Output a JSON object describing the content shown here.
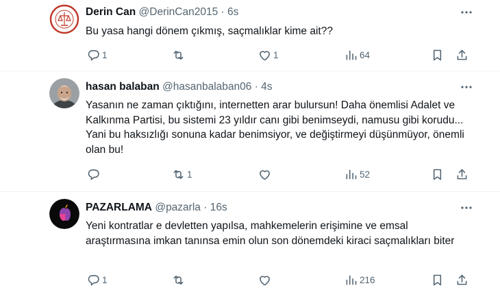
{
  "tweets": [
    {
      "name": "Derin Can",
      "handle": "@DerinCan2015",
      "separator": "·",
      "time": "6s",
      "text": "Bu yasa hangi dönem çıkmış, saçmalıklar kime ait??",
      "replies": "1",
      "reposts": "",
      "likes": "1",
      "views": "64",
      "avatar_colors": {
        "ring": "#c0392b",
        "bg": "#ffffff"
      }
    },
    {
      "name": "hasan balaban",
      "handle": "@hasanbalaban06",
      "separator": "·",
      "time": "4s",
      "text": "Yasanın ne zaman çıktığını, internetten arar bulursun! Daha önemlisi  Adalet ve Kalkınma Partisi, bu sistemi 23 yıldır canı gibi benimseydi, namusu gibi korudu... Yani bu haksızlığı sonuna kadar benimsiyor, ve değiştirmeyi düşünmüyor, önemli olan bu!",
      "replies": "",
      "reposts": "1",
      "likes": "",
      "views": "52",
      "avatar_colors": {
        "bg": "#8a8f92",
        "face": "#c9a48a"
      }
    },
    {
      "name": "PAZARLAMA",
      "handle": "@pazarla",
      "separator": "·",
      "time": "16s",
      "text": "Yeni kontratlar e devletten yapılsa, mahkemelerin erişimine ve emsal araştırmasına imkan tanınsa  emin olun son dönemdeki kiraci saçmalıkları biter",
      "replies": "1",
      "reposts": "",
      "likes": "",
      "views": "216",
      "avatar_colors": {
        "bg": "#0a0a0a",
        "accent": "#e84393"
      }
    }
  ],
  "icons": {
    "reply": "reply-icon",
    "repost": "repost-icon",
    "like": "heart-icon",
    "views": "views-icon",
    "bookmark": "bookmark-icon",
    "share": "share-icon",
    "more": "more-icon"
  },
  "colors": {
    "text": "#0f1419",
    "secondary": "#536471",
    "divider": "#eff3f4"
  }
}
